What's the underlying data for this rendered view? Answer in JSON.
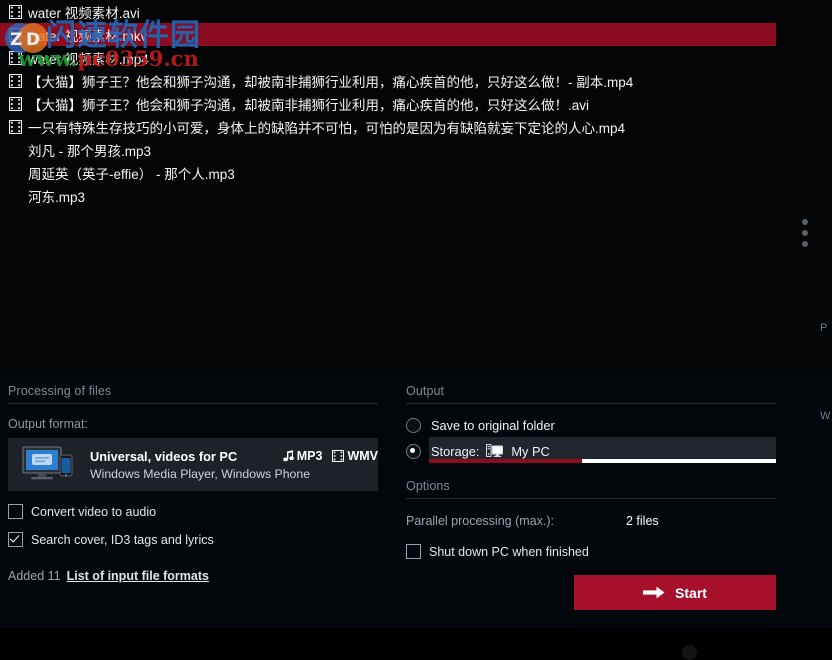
{
  "file_list": {
    "rows": [
      {
        "icon": "film-strip-icon",
        "label": "water 视频素材.avi",
        "selected": false
      },
      {
        "icon": "film-strip-icon",
        "label": "water 视频素材.mkv",
        "selected": true
      },
      {
        "icon": "film-strip-icon",
        "label": "water 视频素材.mp4",
        "selected": false
      },
      {
        "icon": "film-strip-icon",
        "label": "【大猫】狮子王？他会和狮子沟通，却被南非捕狮行业利用，痛心疾首的他，只好这么做！- 副本.mp4",
        "selected": false
      },
      {
        "icon": "film-strip-icon",
        "label": "【大猫】狮子王？他会和狮子沟通，却被南非捕狮行业利用，痛心疾首的他，只好这么做！.avi",
        "selected": false
      },
      {
        "icon": "film-strip-icon",
        "label": "一只有特殊生存技巧的小可爱，身体上的缺陷并不可怕，可怕的是因为有缺陷就妄下定论的人心.mp4",
        "selected": false
      },
      {
        "icon": "none",
        "label": "刘凡 - 那个男孩.mp3",
        "selected": false
      },
      {
        "icon": "none",
        "label": "周延英（英子-effie） - 那个人.mp3",
        "selected": false
      },
      {
        "icon": "none",
        "label": "河东.mp3",
        "selected": false
      }
    ]
  },
  "watermark": {
    "site_name": "闪速软件园",
    "url_green": "www.",
    "url_red": "pc0359.cn",
    "full_url": "www.pc0359.cn"
  },
  "edge_panel": {
    "fragment_1": "P",
    "fragment_2": "W"
  },
  "processing": {
    "title": "Processing of files",
    "output_format_label": "Output format:",
    "format": {
      "name": "Universal, videos for PC",
      "subtitle": "Windows Media Player, Windows Phone",
      "badge_audio": "MP3",
      "badge_video": "WMV"
    },
    "convert_to_audio_label": "Convert video to audio",
    "convert_to_audio_checked": false,
    "search_cover_label": "Search cover, ID3 tags and lyrics",
    "search_cover_checked": true,
    "added_text": "Added 11",
    "formats_link": "List of input file formats"
  },
  "output": {
    "title": "Output",
    "save_original_label": "Save to original folder",
    "save_original_selected": false,
    "storage_label": "Storage:",
    "storage_value": "My PC",
    "storage_selected": true,
    "storage_used_percent": 44
  },
  "options": {
    "title": "Options",
    "parallel_label": "Parallel processing (max.):",
    "parallel_value": "2 files",
    "shutdown_label": "Shut down PC when finished",
    "shutdown_checked": false
  },
  "actions": {
    "start_label": "Start"
  },
  "colors": {
    "accent_red": "#a7102a",
    "selection_red": "#8c0d21",
    "panel_bg": "#03070b",
    "card_bg": "#1d2228"
  }
}
